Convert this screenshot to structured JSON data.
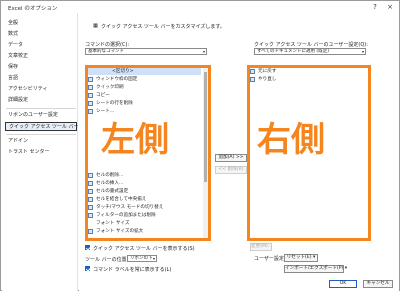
{
  "window": {
    "title": "Excel のオプション",
    "help_icon": "?",
    "close_icon": "×"
  },
  "sidebar": {
    "items": [
      {
        "label": "全般"
      },
      {
        "label": "数式"
      },
      {
        "label": "データ"
      },
      {
        "label": "文章校正"
      },
      {
        "label": "保存"
      },
      {
        "label": "言語"
      },
      {
        "label": "アクセシビリティ"
      },
      {
        "label": "詳細設定"
      },
      {
        "label": "リボンのユーザー設定"
      },
      {
        "label": "クイック アクセス ツール バー"
      },
      {
        "label": "アドイン"
      },
      {
        "label": "トラスト センター"
      }
    ],
    "selected": "クイック アクセス ツール バー"
  },
  "header": {
    "description": "クイック アクセス ツール バーをカスタマイズします。"
  },
  "left_panel": {
    "command_label": "コマンドの選択(C):",
    "command_value": "基本的なコマンド",
    "items": [
      {
        "label": "<区切り>"
      },
      {
        "label": "ウィンドウ枠の固定"
      },
      {
        "label": "クイック印刷"
      },
      {
        "label": "コピー"
      },
      {
        "label": "シートの行を削除"
      },
      {
        "label": "シート..."
      },
      {
        "label": "セルの削除..."
      },
      {
        "label": "セルの挿入..."
      },
      {
        "label": "セルの書式設定"
      },
      {
        "label": "セルを結合して中央揃え"
      },
      {
        "label": "タッチ/マウス モードの切り替え"
      },
      {
        "label": "フィルターの追加または削除"
      },
      {
        "label": "フォント サイズ"
      },
      {
        "label": "フォント サイズの拡大"
      }
    ],
    "overlay": "左側"
  },
  "right_panel": {
    "setting_label": "クイック アクセス ツール バーのユーザー設定(Q):",
    "setting_value": "すべてのドキュメントに適用 (既定)",
    "items": [
      {
        "label": "元に戻す"
      },
      {
        "label": "やり直し"
      }
    ],
    "overlay": "右側"
  },
  "buttons": {
    "add": "追加(A) >>",
    "remove": "<< 削除(R)",
    "modify": "変更(M)...",
    "reset_label": "ユーザー設定:",
    "reset": "リセット(E) ▾",
    "import_export": "インポート/エクスポート(P) ▾",
    "ok": "OK",
    "cancel": "キャンセル"
  },
  "options": {
    "show_toolbar": "クイック アクセス ツール バーを表示する(S)",
    "position_label": "ツール バーの位置(R)",
    "position_value": "リボンの下",
    "show_labels": "コマンド ラベルを常に表示する(L)"
  },
  "colors": {
    "accent": "#f5851f",
    "selection": "#cde0f7",
    "primary": "#1f5fbf"
  }
}
